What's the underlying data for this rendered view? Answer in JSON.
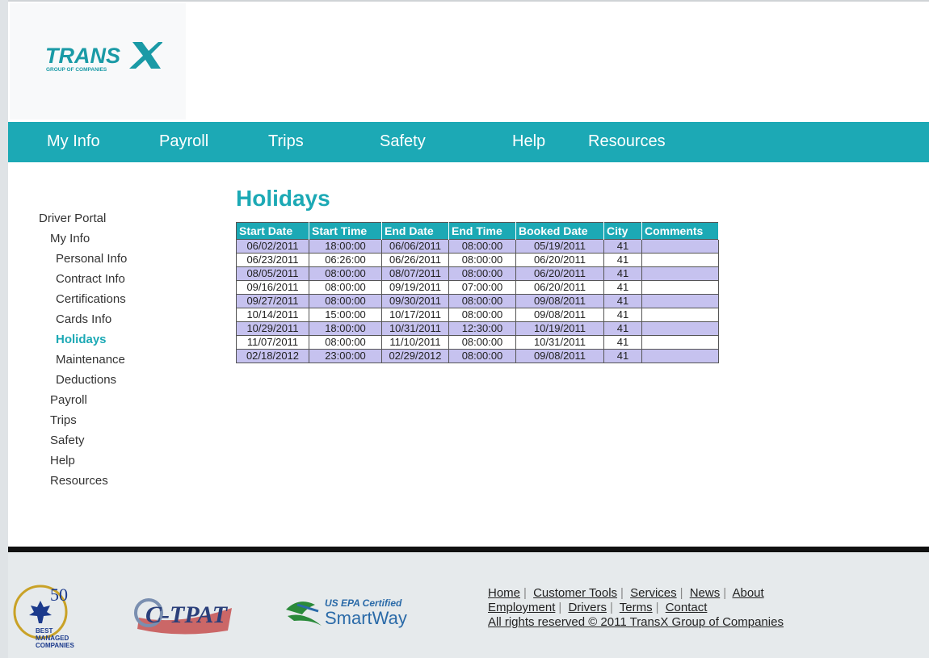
{
  "brand": {
    "name": "TRANSX",
    "tagline": "GROUP OF COMPANIES",
    "color": "#1ca9b5"
  },
  "nav": [
    "My Info",
    "Payroll",
    "Trips",
    "Safety",
    "Help",
    "Resources"
  ],
  "page": {
    "title": "Holidays"
  },
  "sidebar": [
    {
      "label": "Driver Portal",
      "level": 0
    },
    {
      "label": "My Info",
      "level": 1
    },
    {
      "label": "Personal Info",
      "level": 2
    },
    {
      "label": "Contract Info",
      "level": 2
    },
    {
      "label": "Certifications",
      "level": 2
    },
    {
      "label": "Cards Info",
      "level": 2
    },
    {
      "label": "Holidays",
      "level": 2,
      "active": true
    },
    {
      "label": "Maintenance",
      "level": 2
    },
    {
      "label": "Deductions",
      "level": 2
    },
    {
      "label": "Payroll",
      "level": 1
    },
    {
      "label": "Trips",
      "level": 1
    },
    {
      "label": "Safety",
      "level": 1
    },
    {
      "label": "Help",
      "level": 1
    },
    {
      "label": "Resources",
      "level": 1
    }
  ],
  "table": {
    "headers": [
      "Start Date",
      "Start Time",
      "End Date",
      "End Time",
      "Booked Date",
      "City",
      "Comments"
    ],
    "rows": [
      [
        "06/02/2011",
        "18:00:00",
        "06/06/2011",
        "08:00:00",
        "05/19/2011",
        "41",
        ""
      ],
      [
        "06/23/2011",
        "06:26:00",
        "06/26/2011",
        "08:00:00",
        "06/20/2011",
        "41",
        ""
      ],
      [
        "08/05/2011",
        "08:00:00",
        "08/07/2011",
        "08:00:00",
        "06/20/2011",
        "41",
        ""
      ],
      [
        "09/16/2011",
        "08:00:00",
        "09/19/2011",
        "07:00:00",
        "06/20/2011",
        "41",
        ""
      ],
      [
        "09/27/2011",
        "08:00:00",
        "09/30/2011",
        "08:00:00",
        "09/08/2011",
        "41",
        ""
      ],
      [
        "10/14/2011",
        "15:00:00",
        "10/17/2011",
        "08:00:00",
        "09/08/2011",
        "41",
        ""
      ],
      [
        "10/29/2011",
        "18:00:00",
        "10/31/2011",
        "12:30:00",
        "10/19/2011",
        "41",
        ""
      ],
      [
        "11/07/2011",
        "08:00:00",
        "11/10/2011",
        "08:00:00",
        "10/31/2011",
        "41",
        ""
      ],
      [
        "02/18/2012",
        "23:00:00",
        "02/29/2012",
        "08:00:00",
        "09/08/2011",
        "41",
        ""
      ]
    ]
  },
  "footer": {
    "badges": {
      "best_managed_number": "50",
      "best_managed_text": [
        "BEST",
        "MANAGED",
        "COMPANIES"
      ],
      "ctpat": "C-TPAT",
      "smartway_top": "US EPA Certified",
      "smartway_main": "SmartWay"
    },
    "links_row1": [
      "Home",
      "Customer Tools",
      "Services",
      "News",
      "About"
    ],
    "links_row2": [
      "Employment",
      "Drivers",
      "Terms",
      "Contact"
    ],
    "copyright": "All rights reserved © 2011 TransX Group of Companies"
  }
}
